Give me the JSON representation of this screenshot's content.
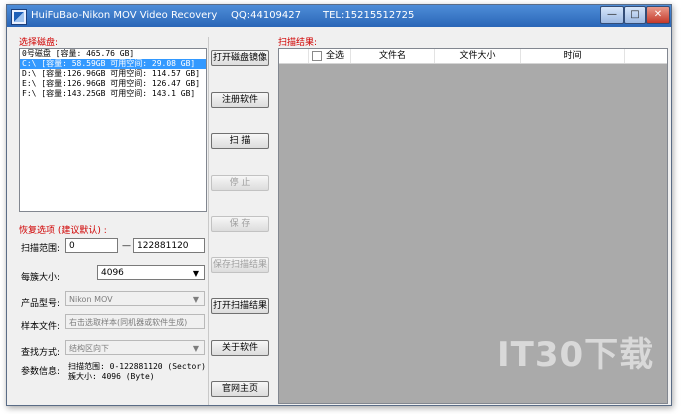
{
  "window": {
    "title_app": "HuiFuBao-Nikon MOV Video Recovery",
    "title_qq": "QQ:44109427",
    "title_tel": "TEL:15215512725",
    "minimize": "—",
    "maximize": "□",
    "close": "✕"
  },
  "disk_panel": {
    "label": "选择磁盘:",
    "items": [
      "0号磁盘 [容量: 465.76 GB]",
      "C:\\ [容量: 58.59GB 可用空间: 29.08 GB]",
      "D:\\ [容量:126.96GB 可用空间: 114.57 GB]",
      "E:\\ [容量:126.96GB 可用空间: 126.47 GB]",
      "F:\\ [容量:143.25GB 可用空间: 143.1 GB]"
    ],
    "selected_index": 1
  },
  "options": {
    "label": "恢复选项 (建议默认) :",
    "scan_range_label": "扫描范围:",
    "scan_start": "0",
    "range_dash": "—",
    "scan_end": "122881120",
    "cluster_label": "每簇大小:",
    "cluster_value": "4096",
    "model_label": "产品型号:",
    "model_value": "Nikon MOV",
    "sample_label": "样本文件:",
    "sample_value": "右击选取样本(同机器或软件生成)",
    "search_label": "查找方式:",
    "search_value": "结构区向下",
    "param_label": "参数信息:",
    "param_line1": "扫描范围: 0-122881120 (Sector)",
    "param_line2": "簇大小: 4096 (Byte)"
  },
  "buttons": {
    "open_image": "打开磁盘镜像",
    "register": "注册软件",
    "scan": "扫  描",
    "stop": "停  止",
    "save": "保  存",
    "save_results": "保存扫描结果",
    "open_results": "打开扫描结果",
    "about": "关于软件",
    "homepage": "官网主页"
  },
  "results": {
    "label": "扫描结果:",
    "columns": [
      "全选",
      "文件名",
      "文件大小",
      "时间"
    ]
  },
  "watermark": "IT30下载"
}
